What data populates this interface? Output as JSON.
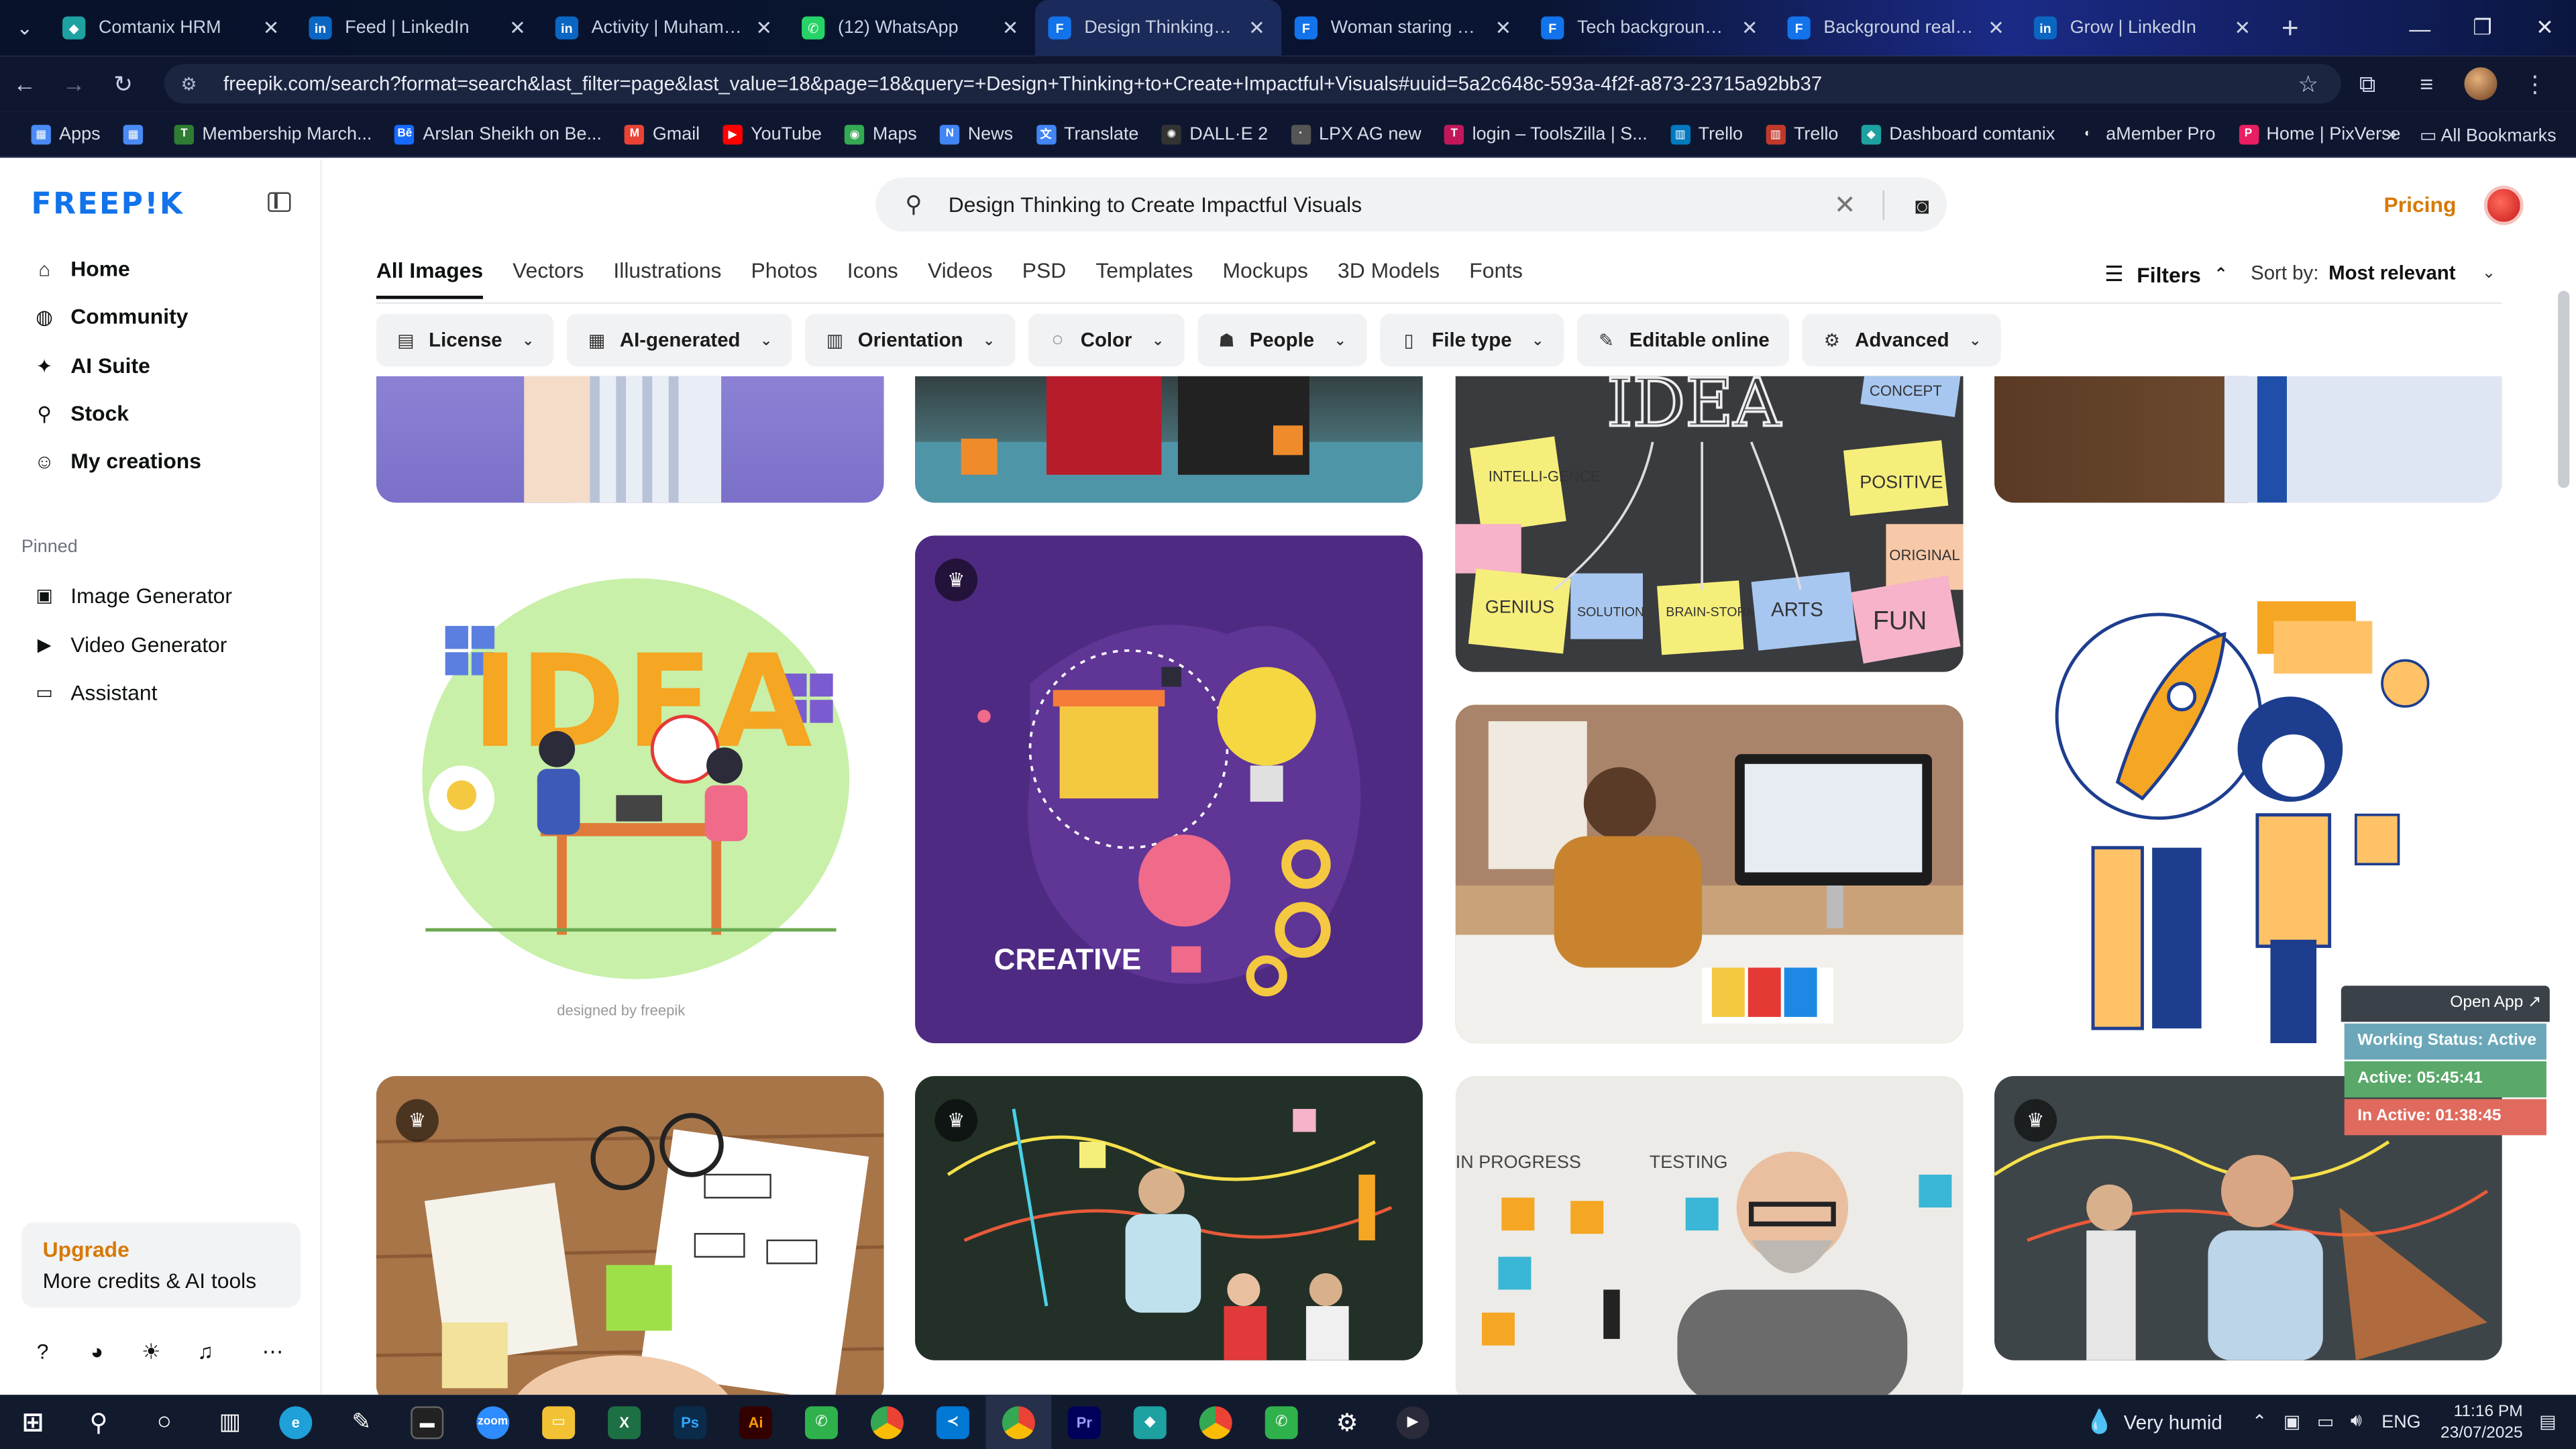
{
  "browser": {
    "tabs": [
      {
        "title": "Comtanix HRM",
        "icon_color": "#1da1a1",
        "icon_glyph": "◆"
      },
      {
        "title": "Feed | LinkedIn",
        "icon_color": "#0a66c2",
        "icon_glyph": "in"
      },
      {
        "title": "Activity | Muhammad",
        "icon_color": "#0a66c2",
        "icon_glyph": "in"
      },
      {
        "title": "(12) WhatsApp",
        "icon_color": "#25d366",
        "icon_glyph": "✆"
      },
      {
        "title": "Design Thinking to C",
        "icon_color": "#1273eb",
        "icon_glyph": "F"
      },
      {
        "title": "Woman staring at a l",
        "icon_color": "#1273eb",
        "icon_glyph": "F"
      },
      {
        "title": "Tech background vec",
        "icon_color": "#1273eb",
        "icon_glyph": "F"
      },
      {
        "title": "Background realistic",
        "icon_color": "#1273eb",
        "icon_glyph": "F"
      },
      {
        "title": "Grow | LinkedIn",
        "icon_color": "#0a66c2",
        "icon_glyph": "in"
      }
    ],
    "url": "freepik.com/search?format=search&last_filter=page&last_value=18&page=18&query=+Design+Thinking+to+Create+Impactful+Visuals#uuid=5a2c648c-593a-4f2f-a873-23715a92bb37",
    "bookmarks": [
      {
        "label": "Apps",
        "icon_color": "#4a8af4",
        "glyph": "▦"
      },
      {
        "label": "",
        "icon_color": "#4a8af4",
        "glyph": "▦"
      },
      {
        "label": "Membership March...",
        "icon_color": "#2e7d32",
        "glyph": "T"
      },
      {
        "label": "Arslan Sheikh on Be...",
        "icon_color": "#1769ff",
        "glyph": "Bē"
      },
      {
        "label": "Gmail",
        "icon_color": "#ea4335",
        "glyph": "M"
      },
      {
        "label": "YouTube",
        "icon_color": "#ff0000",
        "glyph": "▶"
      },
      {
        "label": "Maps",
        "icon_color": "#34a853",
        "glyph": "◉"
      },
      {
        "label": "News",
        "icon_color": "#4285f4",
        "glyph": "N"
      },
      {
        "label": "Translate",
        "icon_color": "#4285f4",
        "glyph": "文"
      },
      {
        "label": "DALL·E 2",
        "icon_color": "#333333",
        "glyph": "✺"
      },
      {
        "label": "LPX AG new",
        "icon_color": "#555555",
        "glyph": "·"
      },
      {
        "label": "login – ToolsZilla | S...",
        "icon_color": "#c2185b",
        "glyph": "T"
      },
      {
        "label": "Trello",
        "icon_color": "#0079bf",
        "glyph": "▥"
      },
      {
        "label": "Trello",
        "icon_color": "#c0392b",
        "glyph": "▥"
      },
      {
        "label": "Dashboard comtanix",
        "icon_color": "#1da1a1",
        "glyph": "◆"
      },
      {
        "label": "aMember Pro",
        "icon_color": "#ffffff",
        "glyph": "◐"
      },
      {
        "label": "Home | PixVerse",
        "icon_color": "#e91e63",
        "glyph": "P"
      }
    ],
    "all_bookmarks": "All Bookmarks"
  },
  "sidebar": {
    "logo": "FREEP!K",
    "nav": [
      {
        "label": "Home",
        "icon": "home-icon",
        "glyph": "⌂"
      },
      {
        "label": "Community",
        "icon": "globe-icon",
        "glyph": "◍"
      },
      {
        "label": "AI Suite",
        "icon": "sparkle-icon",
        "glyph": "✦"
      },
      {
        "label": "Stock",
        "icon": "search-icon",
        "glyph": "⚲"
      },
      {
        "label": "My creations",
        "icon": "user-icon",
        "glyph": "☺"
      }
    ],
    "pinned_label": "Pinned",
    "pinned": [
      {
        "label": "Image Generator",
        "icon": "image-icon",
        "glyph": "▣"
      },
      {
        "label": "Video Generator",
        "icon": "video-icon",
        "glyph": "▶"
      },
      {
        "label": "Assistant",
        "icon": "chat-icon",
        "glyph": "▭"
      }
    ],
    "upgrade": {
      "title": "Upgrade",
      "subtitle": "More credits & AI tools"
    }
  },
  "search": {
    "query": "Design Thinking to Create Impactful Visuals"
  },
  "header": {
    "pricing": "Pricing"
  },
  "type_tabs": [
    "All Images",
    "Vectors",
    "Illustrations",
    "Photos",
    "Icons",
    "Videos",
    "PSD",
    "Templates",
    "Mockups",
    "3D Models",
    "Fonts"
  ],
  "filters_label": "Filters",
  "sort": {
    "label": "Sort by:",
    "value": "Most relevant"
  },
  "chips": [
    {
      "label": "License",
      "glyph": "▤"
    },
    {
      "label": "AI-generated",
      "glyph": "▦"
    },
    {
      "label": "Orientation",
      "glyph": "▥"
    },
    {
      "label": "Color",
      "glyph": "◌"
    },
    {
      "label": "People",
      "glyph": "☗"
    },
    {
      "label": "File type",
      "glyph": "▯"
    },
    {
      "label": "Editable online",
      "glyph": "✎"
    },
    {
      "label": "Advanced",
      "glyph": "⚙"
    }
  ],
  "images": {
    "idea_sticky_words": [
      "IDEA",
      "CONCEPT",
      "INTELLI-GENCE",
      "POSITIVE",
      "ORIGINAL",
      "GENIUS",
      "SOLUTION",
      "BRAIN-STORMING",
      "ARTS",
      "FUN"
    ],
    "creative_caption": "CREATIVE",
    "idea_illustration_title": "IDEA",
    "freepik_credit": "designed by freepik",
    "board_labels": [
      "IN PROGRESS",
      "TESTING"
    ]
  },
  "status_widget": {
    "open_app": "Open App ↗",
    "working": "Working Status: Active",
    "active": "Active: 05:45:41",
    "inactive": "In Active: 01:38:45"
  },
  "taskbar": {
    "weather": "Very humid",
    "lang": "ENG",
    "time": "11:16 PM",
    "date": "23/07/2025"
  }
}
